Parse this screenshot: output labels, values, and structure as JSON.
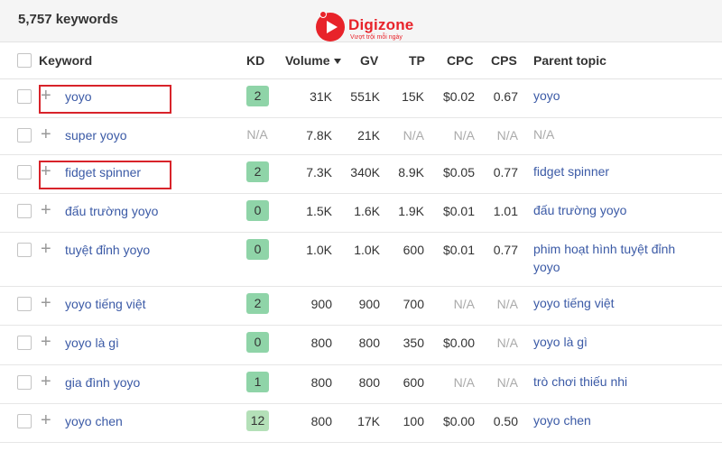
{
  "header": {
    "keyword_count": "5,757 keywords"
  },
  "brand": {
    "name": "Digizone",
    "tagline": "Vượt trội mỗi ngày",
    "color": "#e8232a"
  },
  "columns": {
    "keyword": "Keyword",
    "kd": "KD",
    "volume": "Volume",
    "gv": "GV",
    "tp": "TP",
    "cpc": "CPC",
    "cps": "CPS",
    "parent": "Parent topic"
  },
  "rows": [
    {
      "keyword": "yoyo",
      "kd": "2",
      "volume": "31K",
      "gv": "551K",
      "tp": "15K",
      "cpc": "$0.02",
      "cps": "0.67",
      "parent": "yoyo",
      "highlighted": true
    },
    {
      "keyword": "super yoyo",
      "kd": "N/A",
      "volume": "7.8K",
      "gv": "21K",
      "tp": "N/A",
      "cpc": "N/A",
      "cps": "N/A",
      "parent": "N/A"
    },
    {
      "keyword": "fidget spinner",
      "kd": "2",
      "volume": "7.3K",
      "gv": "340K",
      "tp": "8.9K",
      "cpc": "$0.05",
      "cps": "0.77",
      "parent": "fidget spinner",
      "highlighted": true
    },
    {
      "keyword": "đấu trường yoyo",
      "kd": "0",
      "volume": "1.5K",
      "gv": "1.6K",
      "tp": "1.9K",
      "cpc": "$0.01",
      "cps": "1.01",
      "parent": "đấu trường yoyo"
    },
    {
      "keyword": "tuyệt đỉnh yoyo",
      "kd": "0",
      "volume": "1.0K",
      "gv": "1.0K",
      "tp": "600",
      "cpc": "$0.01",
      "cps": "0.77",
      "parent": "phim hoạt hình tuyệt đỉnh yoyo"
    },
    {
      "keyword": "yoyo tiếng việt",
      "kd": "2",
      "volume": "900",
      "gv": "900",
      "tp": "700",
      "cpc": "N/A",
      "cps": "N/A",
      "parent": "yoyo tiếng việt"
    },
    {
      "keyword": "yoyo là gì",
      "kd": "0",
      "volume": "800",
      "gv": "800",
      "tp": "350",
      "cpc": "$0.00",
      "cps": "N/A",
      "parent": "yoyo là gì"
    },
    {
      "keyword": "gia đình yoyo",
      "kd": "1",
      "volume": "800",
      "gv": "800",
      "tp": "600",
      "cpc": "N/A",
      "cps": "N/A",
      "parent": "trò chơi thiếu nhi"
    },
    {
      "keyword": "yoyo chen",
      "kd": "12",
      "volume": "800",
      "gv": "17K",
      "tp": "100",
      "cpc": "$0.00",
      "cps": "0.50",
      "parent": "yoyo chen"
    }
  ],
  "colors": {
    "kd_low": "#8fd4a8",
    "kd_mid": "#b4e0b8",
    "link": "#3b5aa6",
    "highlight_box": "#d8232a"
  }
}
